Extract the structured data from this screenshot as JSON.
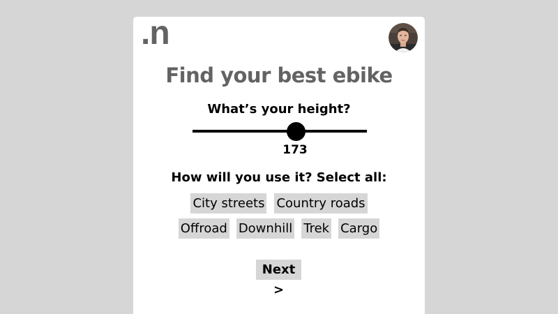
{
  "brand": {
    "logo_text": ".n"
  },
  "header": {
    "avatar_icon": "user-avatar-photo"
  },
  "main": {
    "title": "Find your best ebike",
    "height_question": "What’s your height?",
    "height_slider": {
      "value": "173",
      "level_fraction": 0.59
    },
    "usage_question": "How will you use it? Select all:",
    "usage_options_row1": [
      "City streets",
      "Country roads"
    ],
    "usage_options_row2": [
      "Offroad",
      "Downhill",
      "Trek",
      "Cargo"
    ],
    "next_label": "Next >"
  },
  "colors": {
    "page_background": "#d6d6d6",
    "card_background": "#ffffff",
    "heading_gray": "#636363",
    "chip_background": "#d6d6d6",
    "slider_color": "#000000"
  }
}
